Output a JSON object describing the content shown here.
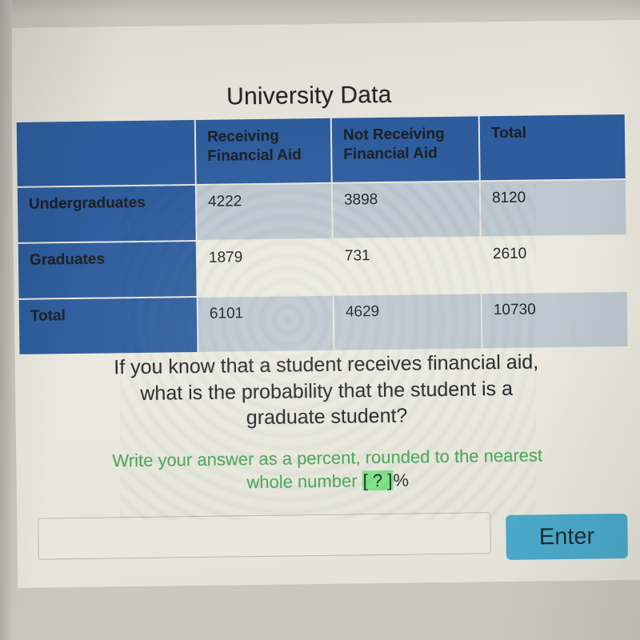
{
  "title": "University Data",
  "table": {
    "columns": [
      "",
      "Receiving Financial Aid",
      "Not Receiving Financial Aid",
      "Total"
    ],
    "header": {
      "blank": "",
      "receiving_line1": "Receiving",
      "receiving_line2": "Financial Aid",
      "not_receiving_line1": "Not Receiving",
      "not_receiving_line2": "Financial Aid",
      "total": "Total"
    },
    "rows": [
      {
        "label": "Undergraduates",
        "receiving": "4222",
        "not_receiving": "3898",
        "total": "8120"
      },
      {
        "label": "Graduates",
        "receiving": "1879",
        "not_receiving": "731",
        "total": "2610"
      },
      {
        "label": "Total",
        "receiving": "6101",
        "not_receiving": "4629",
        "total": "10730"
      }
    ]
  },
  "question": {
    "line1": "If you know that a student receives financial aid,",
    "line2": "what is the probability that the student is a",
    "line3": "graduate student?"
  },
  "instruction": {
    "line1": "Write your answer as a percent, rounded to the nearest",
    "line2_prefix": "whole number",
    "blank": "[ ? ]",
    "suffix": "%"
  },
  "answer": {
    "value": "",
    "placeholder": "",
    "enter_label": "Enter"
  },
  "colors": {
    "header_blue": "#2e5d9e",
    "cell_shaded": "#bfc7d0",
    "cell_plain": "#eceadf",
    "instruction_green": "#4ca85c",
    "blank_highlight": "#7fe089",
    "enter_button": "#4ba8c9",
    "background": "#c9c7be"
  }
}
